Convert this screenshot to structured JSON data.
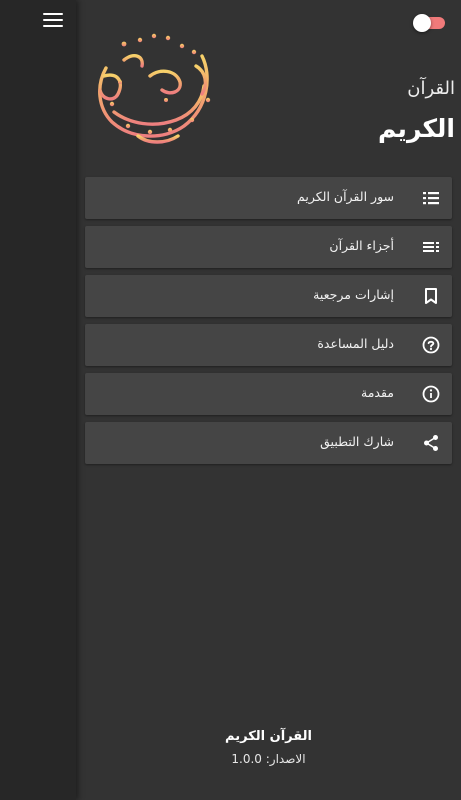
{
  "header": {
    "title_line1": "القرآن",
    "title_line2": "الكريم",
    "toggle_state": "on",
    "accent_color": "#f07a7a"
  },
  "menu": {
    "items": [
      {
        "label": "سور القرآن الكريم",
        "icon": "list-icon"
      },
      {
        "label": "أجزاء القرآن",
        "icon": "playlist-icon"
      },
      {
        "label": "إشارات مرجعية",
        "icon": "bookmark-icon"
      },
      {
        "label": "دليل المساعدة",
        "icon": "help-icon"
      },
      {
        "label": "مقدمة",
        "icon": "info-icon"
      },
      {
        "label": "شارك التطبيق",
        "icon": "share-icon"
      }
    ]
  },
  "footer": {
    "app_name": "القرآن الكريم",
    "version": "الاصدار: 1.0.0"
  }
}
